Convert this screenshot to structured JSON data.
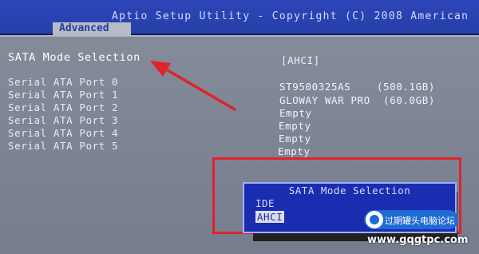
{
  "window": {
    "title": "Aptio Setup Utility - Copyright (C) 2008 American",
    "active_tab": "Advanced"
  },
  "settings": {
    "sata_mode_label": "SATA Mode Selection",
    "sata_mode_value": "[AHCI]",
    "ports": [
      {
        "label": "Serial ATA Port 0",
        "value": "ST9500325AS    (500.1GB)"
      },
      {
        "label": "Serial ATA Port 1",
        "value": "GLOWAY WAR PRO  (60.0GB)"
      },
      {
        "label": "Serial ATA Port 2",
        "value": "Empty"
      },
      {
        "label": "Serial ATA Port 3",
        "value": "Empty"
      },
      {
        "label": "Serial ATA Port 4",
        "value": "Empty"
      },
      {
        "label": "Serial ATA Port 5",
        "value": "Empty"
      }
    ]
  },
  "popup": {
    "title": "SATA Mode Selection",
    "options": [
      "IDE",
      "AHCI"
    ],
    "selected": "AHCI"
  },
  "watermark": {
    "site_name": "过期罐头电脑论坛",
    "url": "www.gqgtpc.com"
  },
  "colors": {
    "annotation_red": "#e0232a",
    "popup_blue": "#1a2cb0",
    "title_blue": "#2c45b8",
    "panel_grey": "#808796"
  }
}
